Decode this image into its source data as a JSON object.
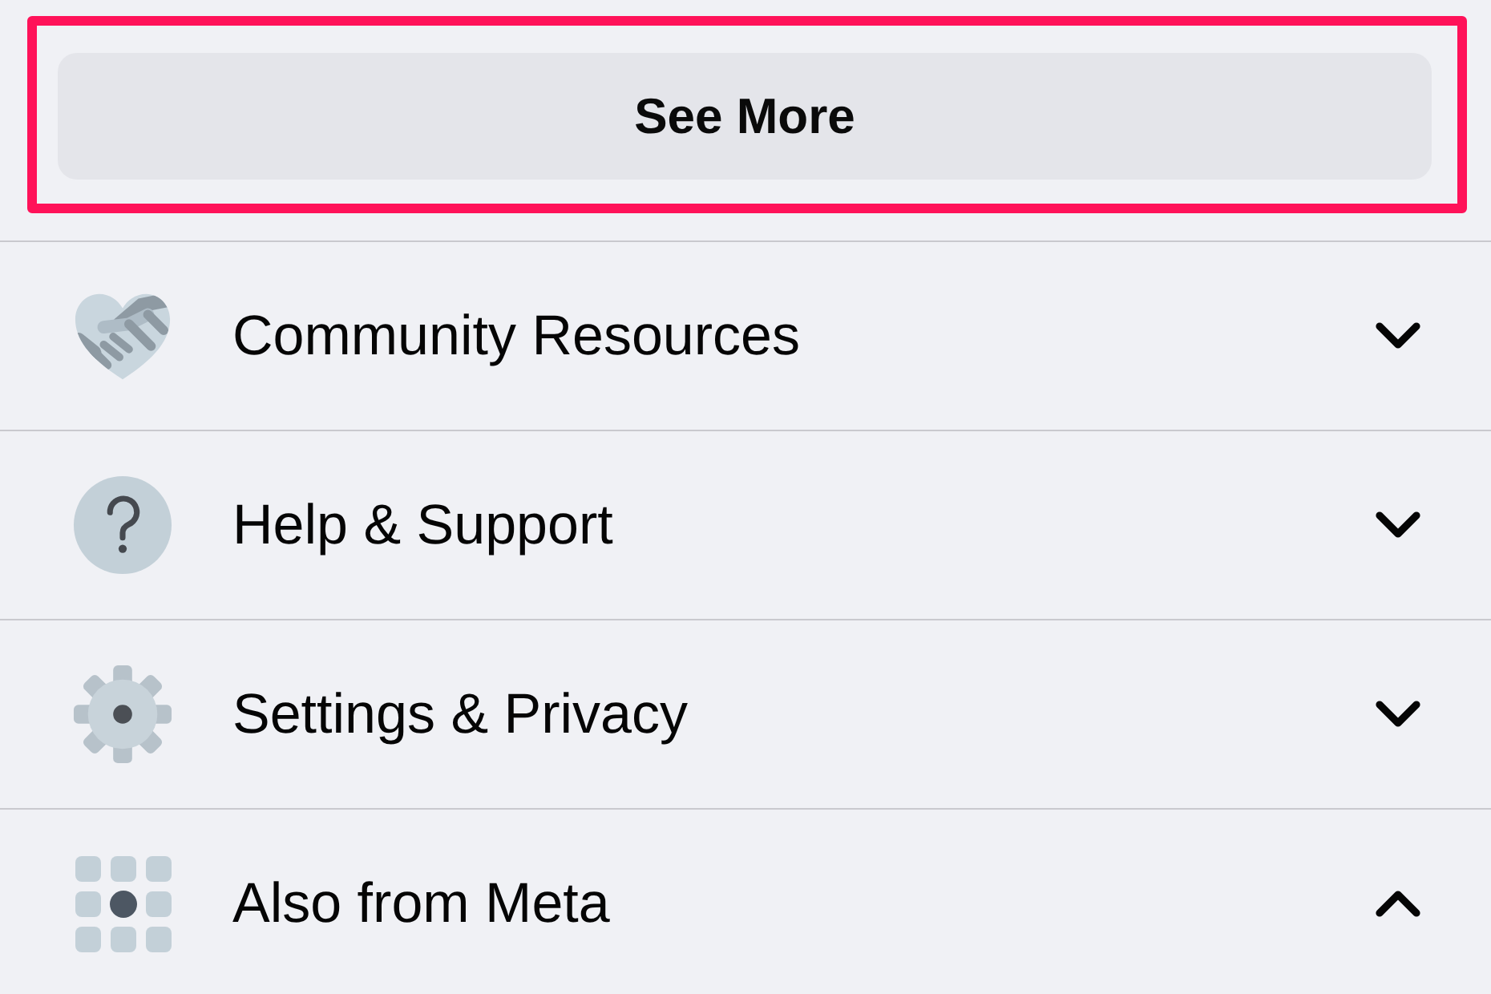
{
  "see_more": {
    "label": "See More",
    "highlighted": true
  },
  "sections": [
    {
      "label": "Community Resources",
      "expanded": false
    },
    {
      "label": "Help & Support",
      "expanded": false
    },
    {
      "label": "Settings & Privacy",
      "expanded": false
    },
    {
      "label": "Also from Meta",
      "expanded": true
    }
  ]
}
